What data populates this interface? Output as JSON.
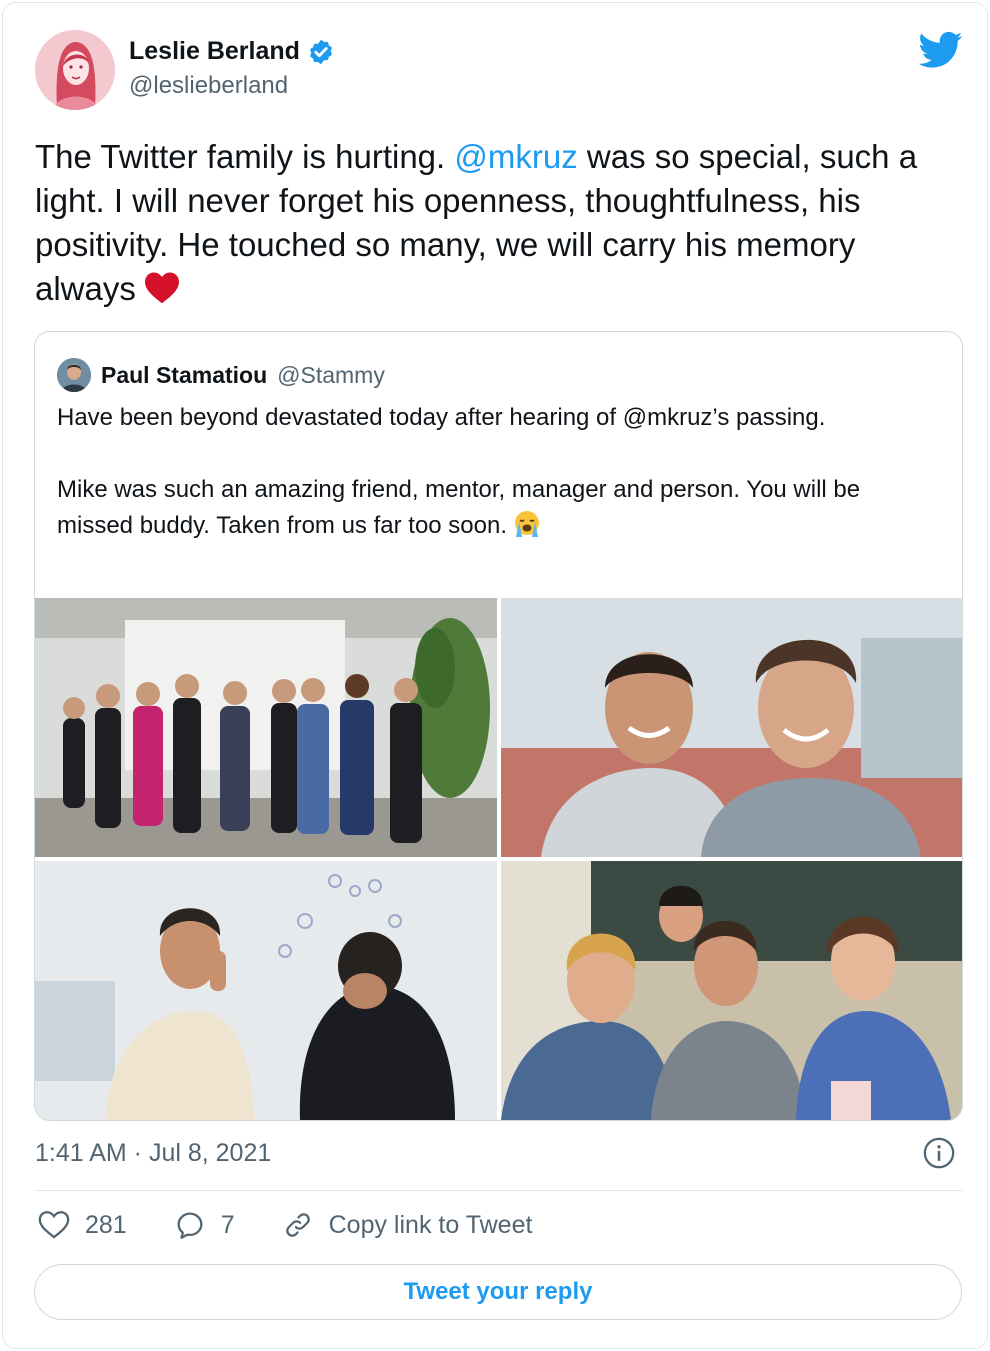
{
  "author": {
    "name": "Leslie Berland",
    "handle": "@leslieberland",
    "verified": true,
    "avatar_icon": "profile-avatar"
  },
  "tweet": {
    "text_before": "The Twitter family is hurting. ",
    "mention": "@mkruz",
    "text_after": " was so special, such a light. I will never forget his openness, thoughtfulness, his positivity. He touched so many, we will carry his memory always",
    "emoji": "red-heart-icon"
  },
  "quoted_tweet": {
    "name": "Paul Stamatiou",
    "handle": "@Stammy",
    "paragraph1": "Have been beyond devastated today after hearing of @mkruz’s passing.",
    "paragraph2": "Mike was such an amazing friend, mentor, manager and person. You will be missed buddy. Taken from us far too soon.",
    "emoji": "loudly-crying-face-icon",
    "photos": [
      "group-on-stage-photo",
      "two-friends-smiling-photo",
      "office-whiteboard-photo",
      "group-selfie-photo"
    ]
  },
  "footer": {
    "timestamp": "1:41 AM · Jul 8, 2021",
    "likes": "281",
    "replies": "7",
    "copy_link": "Copy link to Tweet",
    "reply_button": "Tweet your reply"
  },
  "colors": {
    "accent": "#1d9bf0",
    "text": "#0f1419",
    "secondary": "#536471",
    "border": "#cfd9de",
    "heart": "#d4102a"
  }
}
